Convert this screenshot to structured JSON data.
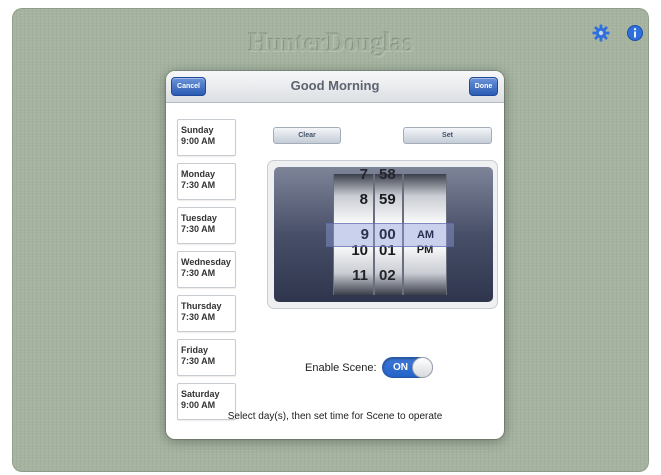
{
  "brand": {
    "name": "HunterDouglas"
  },
  "top_icons": {
    "settings_icon": "gear-icon",
    "info_icon": "info-icon",
    "accent": "#2f6fdd"
  },
  "modal": {
    "title": "Good Morning",
    "cancel_label": "Cancel",
    "done_label": "Done"
  },
  "days": [
    {
      "name": "Sunday",
      "time": "9:00 AM",
      "selected": true
    },
    {
      "name": "Monday",
      "time": "7:30 AM",
      "selected": false
    },
    {
      "name": "Tuesday",
      "time": "7:30 AM",
      "selected": false
    },
    {
      "name": "Wednesday",
      "time": "7:30 AM",
      "selected": false
    },
    {
      "name": "Thursday",
      "time": "7:30 AM",
      "selected": false
    },
    {
      "name": "Friday",
      "time": "7:30 AM",
      "selected": false
    },
    {
      "name": "Saturday",
      "time": "9:00 AM",
      "selected": true
    }
  ],
  "actions": {
    "clear_label": "Clear",
    "set_label": "Set"
  },
  "picker": {
    "hours": [
      "7",
      "8",
      "9",
      "10",
      "11"
    ],
    "minutes": [
      "58",
      "59",
      "00",
      "01",
      "02"
    ],
    "ampm": [
      "",
      "",
      "AM",
      "PM",
      ""
    ],
    "selected": {
      "hour": "9",
      "minute": "00",
      "period": "AM"
    }
  },
  "enable_scene": {
    "label": "Enable Scene:",
    "state": "ON"
  },
  "hint": "Select day(s), then set time for Scene to operate",
  "colors": {
    "selected_day": "#a9c5e8",
    "button_blue": "#2b5bb5",
    "toggle_on": "#2563c8"
  }
}
